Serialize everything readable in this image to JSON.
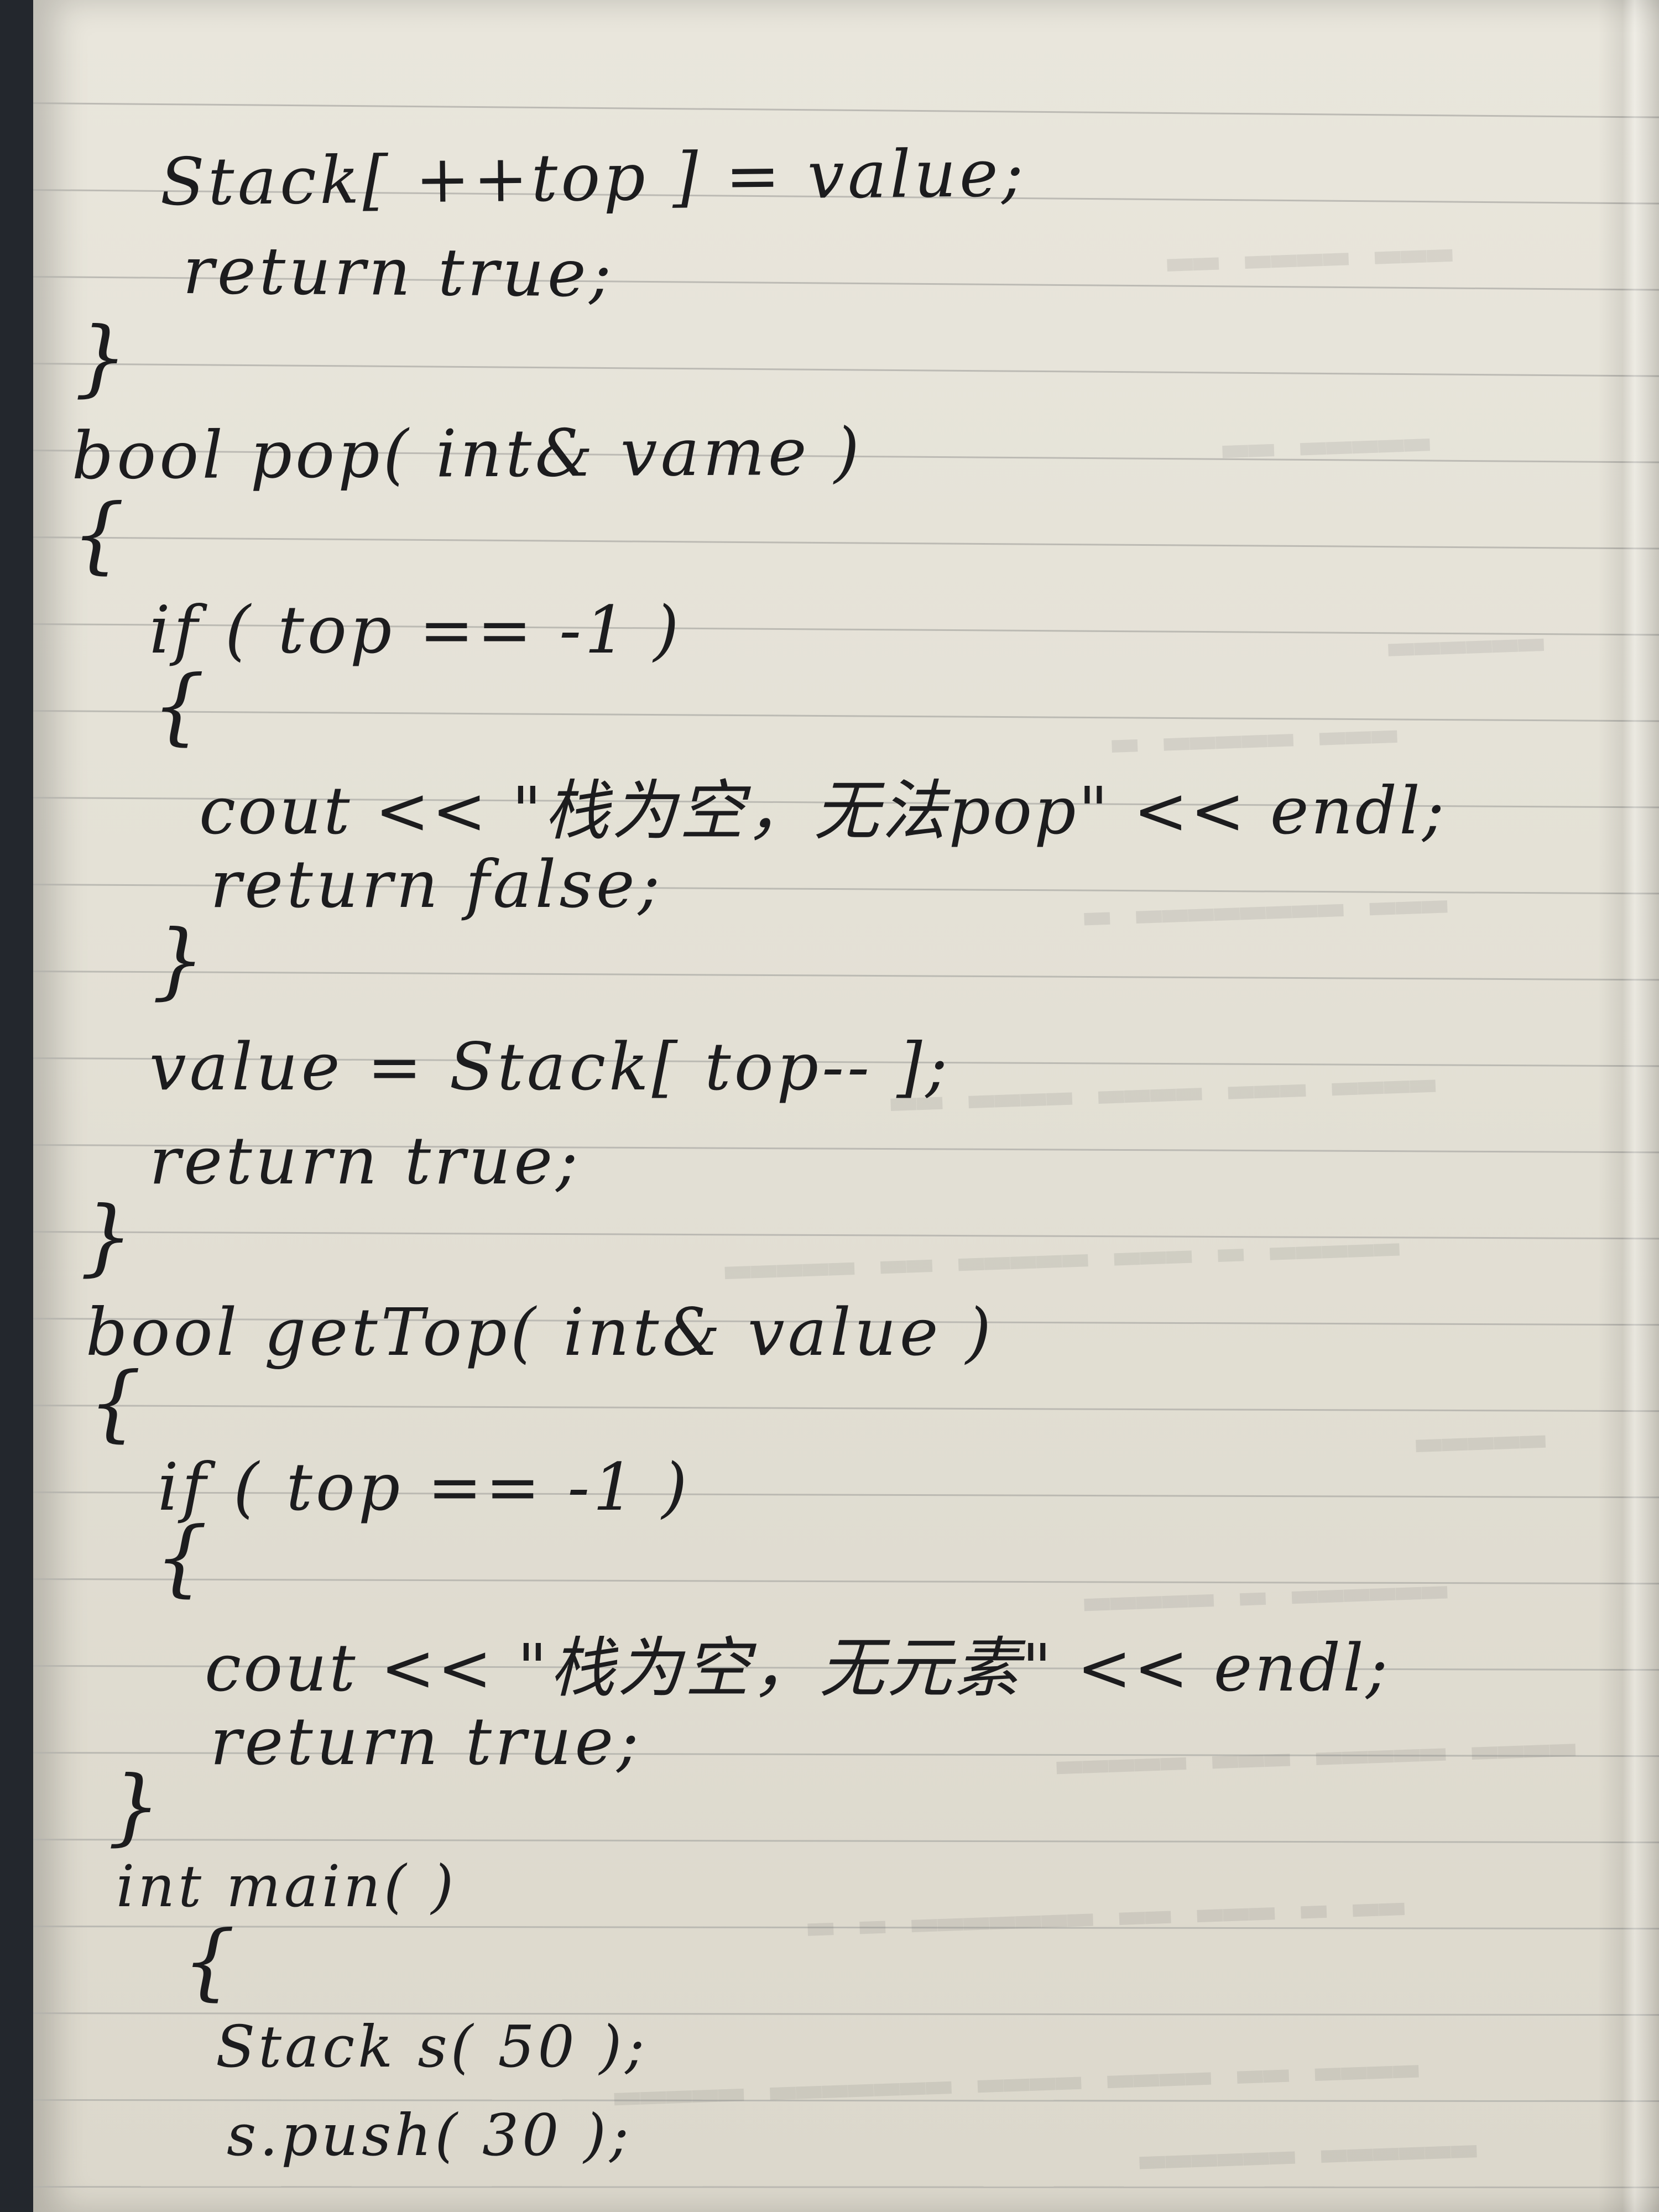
{
  "code_lines": [
    "Stack[ ++top ] = value;",
    "return true;",
    "}",
    "bool pop( int& vame )",
    "{",
    "if ( top == -1 )",
    "{",
    "cout << \"栈为空，无法pop\" << endl;",
    "return false;",
    "}",
    "value = Stack[ top-- ];",
    "return true;",
    "}",
    "bool getTop( int& value )",
    "{",
    "if ( top == -1 )",
    "{",
    "cout << \"栈为空，无元素\" << endl;",
    "return true;",
    "}",
    "int main( )",
    "{",
    "Stack s( 50 );",
    "s.push( 30 );"
  ]
}
